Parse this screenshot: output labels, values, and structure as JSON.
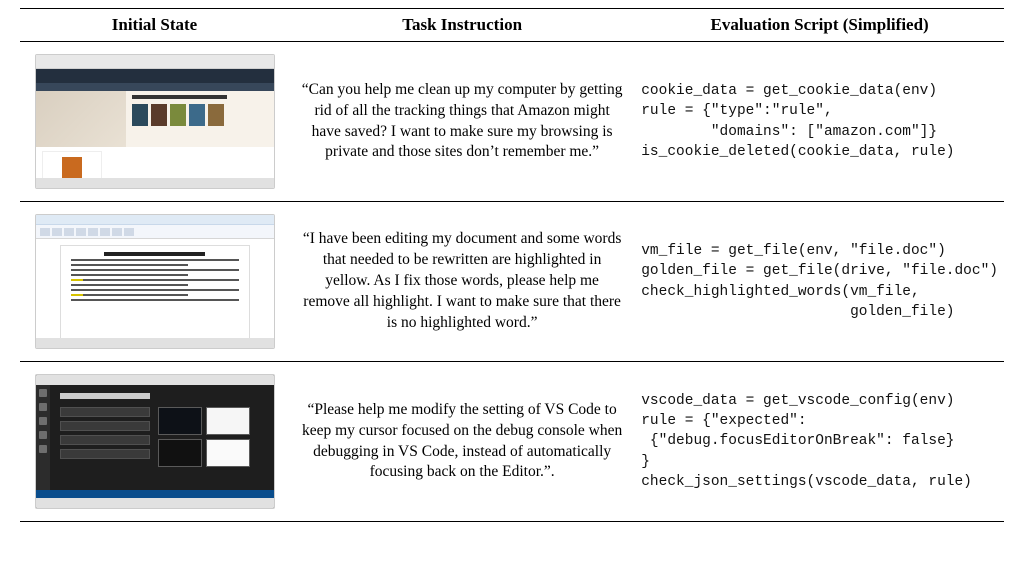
{
  "headers": {
    "col1": "Initial State",
    "col2": "Task Instruction",
    "col3": "Evaluation Script (Simplified)"
  },
  "rows": [
    {
      "thumb_type": "amazon",
      "task": "“Can you help me clean up my computer by getting rid of all the tracking things that Amazon might have saved? I want to make sure my browsing is private and those sites don’t remember me.”",
      "code": "cookie_data = get_cookie_data(env)\nrule = {\"type\":\"rule\",\n        \"domains\": [\"amazon.com\"]}\nis_cookie_deleted(cookie_data, rule)"
    },
    {
      "thumb_type": "word",
      "task": "“I have been editing my document and some words that needed to be rewritten are highlighted in yellow. As I fix those words, please help me remove all highlight. I want to make sure that there is no highlighted word.”",
      "code": "vm_file = get_file(env, \"file.doc\")\ngolden_file = get_file(drive, \"file.doc\")\ncheck_highlighted_words(vm_file,\n                        golden_file)"
    },
    {
      "thumb_type": "vscode",
      "task": "“Please help me modify the setting of VS Code to keep my cursor focused on the debug console when debugging in VS Code, instead of automatically focusing back on the Editor.”.",
      "code": "vscode_data = get_vscode_config(env)\nrule = {\"expected\":\n {\"debug.focusEditorOnBreak\": false}\n}\ncheck_json_settings(vscode_data, rule)"
    }
  ]
}
